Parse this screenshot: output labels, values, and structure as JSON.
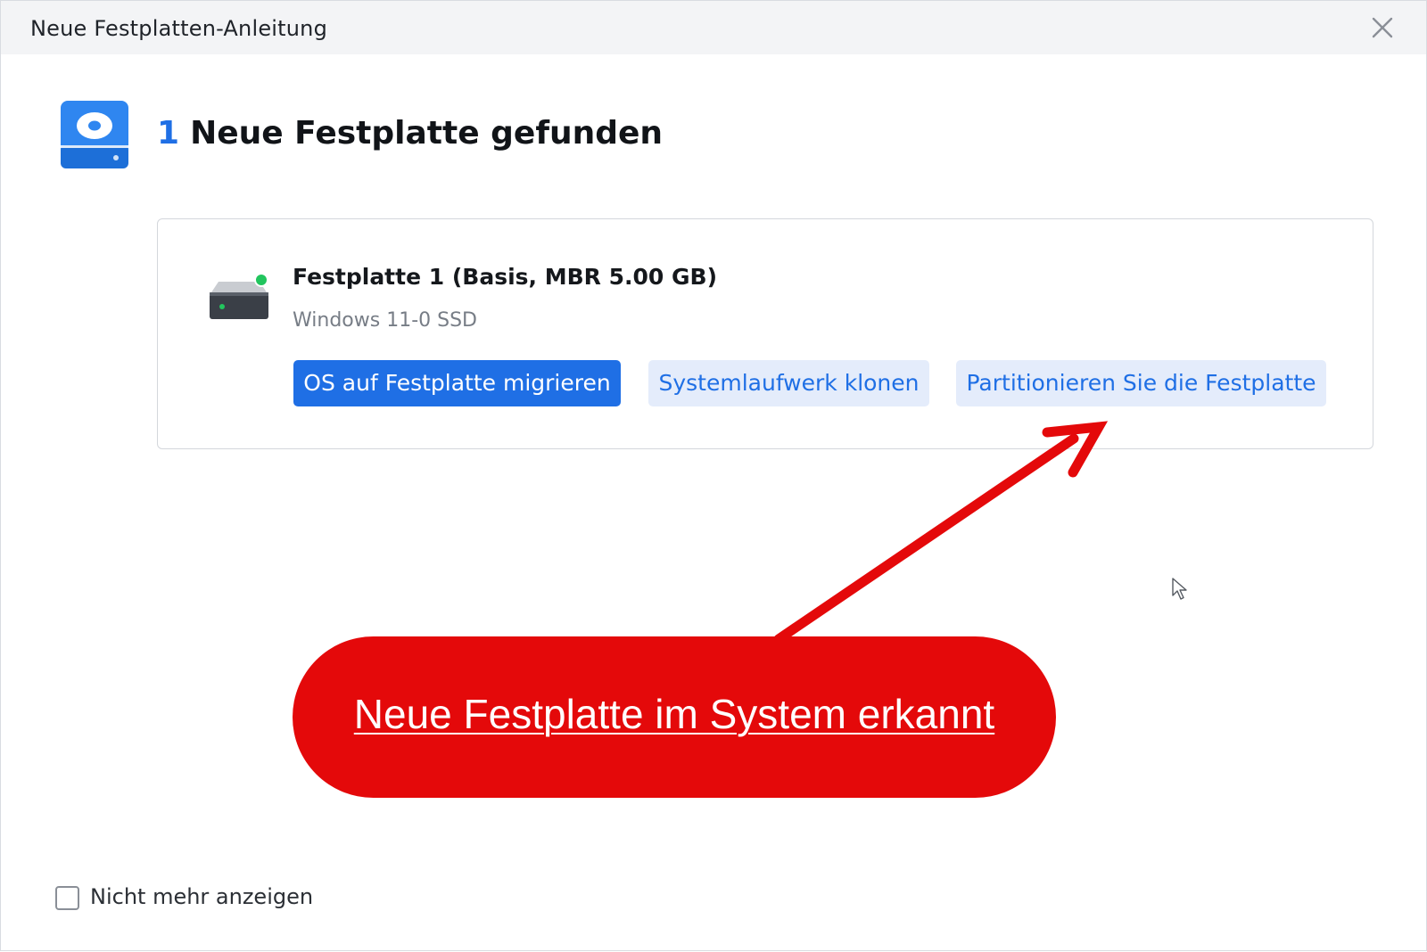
{
  "window": {
    "title": "Neue Festplatten-Anleitung",
    "close_icon": "close-icon"
  },
  "header": {
    "icon": "disk-icon",
    "count": "1",
    "heading": "Neue Festplatte gefunden"
  },
  "disk": {
    "name": "Festplatte 1 (Basis, MBR 5.00 GB)",
    "subtitle": "Windows 11-0 SSD",
    "icon": "hard-drive-icon",
    "status_color": "#22c55e",
    "actions": [
      {
        "label": "OS auf Festplatte migrieren"
      },
      {
        "label": "Systemlaufwerk klonen"
      },
      {
        "label": "Partitionieren Sie die Festplatte"
      }
    ]
  },
  "annotation": {
    "text": "Neue Festplatte im System erkannt",
    "color": "#e4090a"
  },
  "footer": {
    "checkbox_label": "Nicht mehr anzeigen",
    "checked": false
  },
  "colors": {
    "accent": "#1f6fe5",
    "secondary_button_bg": "#e4ecfb"
  }
}
